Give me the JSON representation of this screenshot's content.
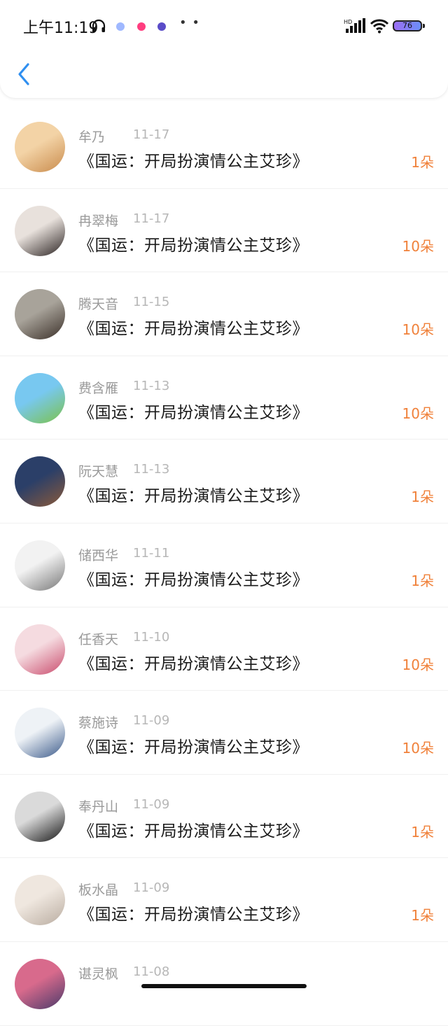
{
  "status": {
    "time": "上午11:19",
    "more": "• •",
    "battery": "76",
    "notif_colors": [
      "#9fb8ff",
      "#ff3d7f",
      "#5a4cc8"
    ]
  },
  "colors": {
    "accent": "#2f8ff0",
    "amount": "#f0813a"
  },
  "records": [
    {
      "name": "牟乃",
      "date": "11-17",
      "title": "《国运：开局扮演情公主艾珍》",
      "amount": "1朵",
      "avatar_colors": [
        "#f3d3a6",
        "#c98b4c"
      ]
    },
    {
      "name": "冉翠梅",
      "date": "11-17",
      "title": "《国运：开局扮演情公主艾珍》",
      "amount": "10朵",
      "avatar_colors": [
        "#e8e1dc",
        "#2a2221"
      ]
    },
    {
      "name": "腾天音",
      "date": "11-15",
      "title": "《国运：开局扮演情公主艾珍》",
      "amount": "10朵",
      "avatar_colors": [
        "#a8a39a",
        "#3a2f28"
      ]
    },
    {
      "name": "费含雁",
      "date": "11-13",
      "title": "《国运：开局扮演情公主艾珍》",
      "amount": "10朵",
      "avatar_colors": [
        "#78c8f0",
        "#7cc24a"
      ]
    },
    {
      "name": "阮天慧",
      "date": "11-13",
      "title": "《国运：开局扮演情公主艾珍》",
      "amount": "1朵",
      "avatar_colors": [
        "#2b3f68",
        "#8b5a3a"
      ]
    },
    {
      "name": "储西华",
      "date": "11-11",
      "title": "《国运：开局扮演情公主艾珍》",
      "amount": "1朵",
      "avatar_colors": [
        "#f2f2f2",
        "#777777"
      ]
    },
    {
      "name": "任香天",
      "date": "11-10",
      "title": "《国运：开局扮演情公主艾珍》",
      "amount": "10朵",
      "avatar_colors": [
        "#f5dbe0",
        "#c94b6c"
      ]
    },
    {
      "name": "蔡施诗",
      "date": "11-09",
      "title": "《国运：开局扮演情公主艾珍》",
      "amount": "10朵",
      "avatar_colors": [
        "#eef2f6",
        "#3b5a8a"
      ]
    },
    {
      "name": "奉丹山",
      "date": "11-09",
      "title": "《国运：开局扮演情公主艾珍》",
      "amount": "1朵",
      "avatar_colors": [
        "#dadada",
        "#151515"
      ]
    },
    {
      "name": "板水晶",
      "date": "11-09",
      "title": "《国运：开局扮演情公主艾珍》",
      "amount": "1朵",
      "avatar_colors": [
        "#efe7df",
        "#b9aca0"
      ]
    },
    {
      "name": "谌灵枫",
      "date": "11-08",
      "title": "",
      "amount": "",
      "avatar_colors": [
        "#d86a8c",
        "#4a3a6a"
      ]
    }
  ]
}
